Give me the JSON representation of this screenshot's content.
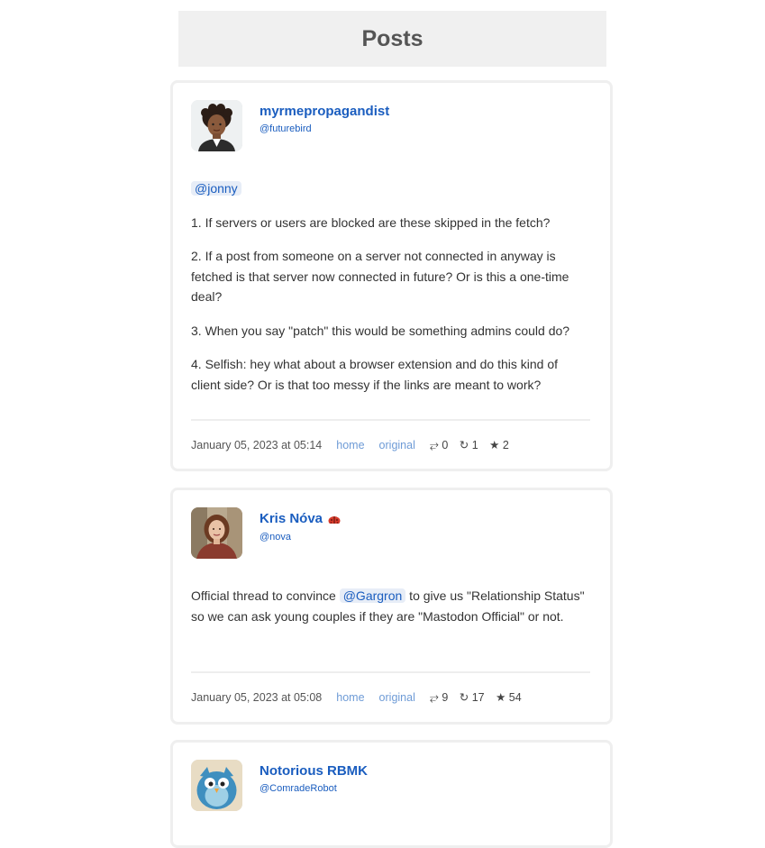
{
  "page": {
    "title": "Posts"
  },
  "posts": [
    {
      "display_name": "myrmepropagandist",
      "handle": "@futurebird",
      "mention": "@jonny",
      "paragraphs": [
        "1. If servers or users are blocked are these skipped in the fetch?",
        "2. If a post from someone on a server not connected in anyway is fetched is that server now connected in future? Or is this a one-time deal?",
        "3. When you say \"patch\" this would be something admins could do?",
        "4. Selfish: hey what about a browser extension and do this kind of client side? Or is that too messy if the links are meant to work?"
      ],
      "date": "January 05, 2023 at 05:14",
      "home_label": "home",
      "original_label": "original",
      "replies": "⥂ 0",
      "boosts": "↻ 1",
      "favs": "★ 2"
    },
    {
      "display_name": "Kris Nóva",
      "handle": "@nova",
      "text_before": "Official thread to convince ",
      "mention": "@Gargron",
      "text_after": " to give us \"Relationship Status\" so we can ask young couples if they are \"Mastodon Official\" or not.",
      "date": "January 05, 2023 at 05:08",
      "home_label": "home",
      "original_label": "original",
      "replies": "⥂ 9",
      "boosts": "↻ 17",
      "favs": "★ 54"
    },
    {
      "display_name": "Notorious RBMK",
      "handle": "@ComradeRobot"
    }
  ],
  "colors": {
    "link": "#1a5dbf",
    "mention_bg": "#e7edf7",
    "meta_link": "#6e9bd6"
  }
}
